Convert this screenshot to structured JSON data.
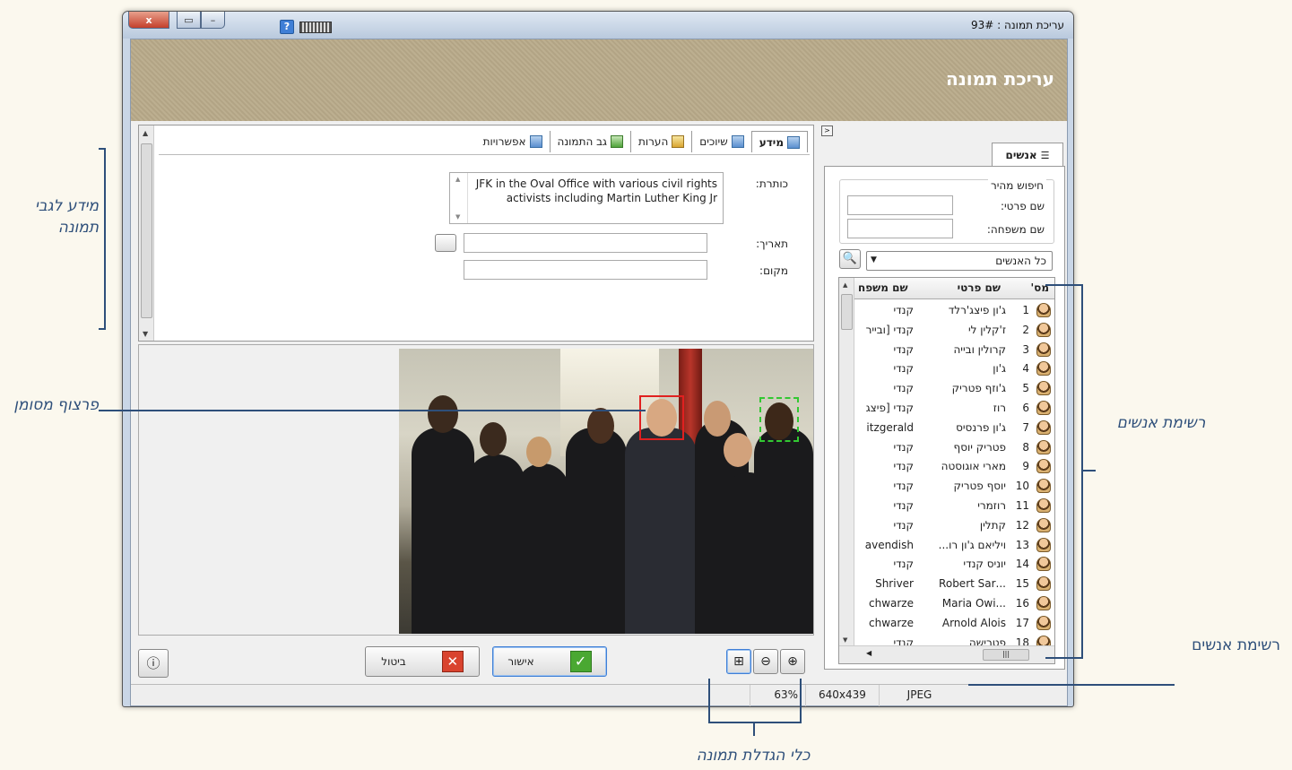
{
  "window": {
    "title": "עריכת תמונה : 93#",
    "close_glyph": "x"
  },
  "banner": {
    "title": "עריכת תמונה"
  },
  "info_tabs": [
    {
      "label": "מידע"
    },
    {
      "label": "שיוכים"
    },
    {
      "label": "הערות"
    },
    {
      "label": "גב התמונה"
    },
    {
      "label": "אפשרויות"
    }
  ],
  "form": {
    "caption_label": "כותרת:",
    "caption_value": "JFK in the Oval Office with various civil rights activists including Martin Luther King Jr",
    "date_label": "תאריך:",
    "date_value": "",
    "place_label": "מקום:",
    "place_value": ""
  },
  "buttons": {
    "ok_label": "אישור",
    "cancel_label": "ביטול"
  },
  "people_panel": {
    "tab_label": "אנשים",
    "quick_search_title": "חיפוש מהיר",
    "first_name_label": "שם פרטי:",
    "last_name_label": "שם משפחה:",
    "first_name_value": "",
    "last_name_value": "",
    "filter_selected": "כל האנשים",
    "columns": [
      "מס'",
      "שם פרטי",
      "שם משפח"
    ],
    "rows": [
      {
        "num": "1",
        "first": "ג'ון פיצג'רלד",
        "last": "קנדי"
      },
      {
        "num": "2",
        "first": "ז'קלין לי",
        "last": "קנדי [ובייר"
      },
      {
        "num": "3",
        "first": "קרולין ובייה",
        "last": "קנדי"
      },
      {
        "num": "4",
        "first": "ג'ון",
        "last": "קנדי"
      },
      {
        "num": "5",
        "first": "ג'וזף פטריק",
        "last": "קנדי"
      },
      {
        "num": "6",
        "first": "רוז",
        "last": "קנדי [פיצג"
      },
      {
        "num": "7",
        "first": "ג'ון פרנסיס",
        "last": "itzgerald"
      },
      {
        "num": "8",
        "first": "פטריק יוסף",
        "last": "קנדי"
      },
      {
        "num": "9",
        "first": "מארי אוגוסטה",
        "last": "קנדי"
      },
      {
        "num": "10",
        "first": "יוסף פטריק",
        "last": "קנדי"
      },
      {
        "num": "11",
        "first": "רוזמרי",
        "last": "קנדי"
      },
      {
        "num": "12",
        "first": "קתלין",
        "last": "קנדי"
      },
      {
        "num": "13",
        "first": "ויליאם ג'ון רו...",
        "last": "avendish"
      },
      {
        "num": "14",
        "first": "יוניס קנדי",
        "last": "קנדי"
      },
      {
        "num": "15",
        "first": "...Robert Sar",
        "last": "Shriver"
      },
      {
        "num": "16",
        "first": "...Maria Owi",
        "last": "chwarze"
      },
      {
        "num": "17",
        "first": "Arnold Alois",
        "last": "chwarze"
      },
      {
        "num": "18",
        "first": "פטרישה",
        "last": "קנדי"
      }
    ]
  },
  "statusbar": {
    "zoom": "63%",
    "dimensions": "640x439",
    "format": "JPEG"
  },
  "annotations": {
    "info_note": "מידע לגבי תמונה",
    "face_note": "פרצוף מסומן",
    "people_list_note": "רשימת אנשים",
    "people_list_note2": "רשימת אנשים",
    "zoom_note": "כלי הגדלת תמונה"
  },
  "colors": {
    "accent": "#2e4f7a",
    "banner": "#b9ab8a",
    "face_marker": "#e02020",
    "face_marker_candidate": "#32c832"
  }
}
